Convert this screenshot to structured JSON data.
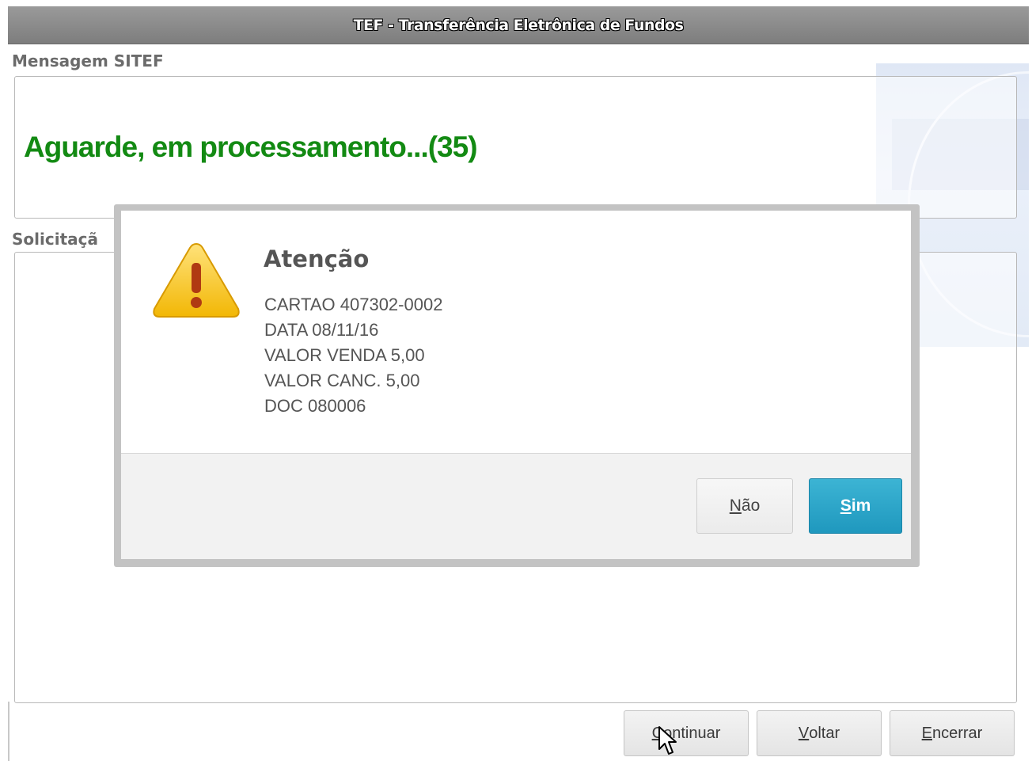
{
  "window": {
    "title": "TEF - Transferência Eletrônica de Fundos"
  },
  "message_group": {
    "label": "Mensagem SITEF",
    "text": "Aguarde, em processamento...(35)",
    "text_color": "#138a13"
  },
  "request_group": {
    "label_visible": "Solicitaçã"
  },
  "buttons": {
    "continuar": {
      "mnemonic": "C",
      "rest": "ontinuar"
    },
    "voltar": {
      "mnemonic": "V",
      "rest": "oltar"
    },
    "encerrar": {
      "mnemonic": "E",
      "rest": "ncerrar"
    }
  },
  "dialog": {
    "icon": "warning-icon",
    "title": "Atenção",
    "lines": [
      "CARTAO 407302-0002",
      "DATA 08/11/16",
      "VALOR VENDA 5,00",
      "VALOR CANC. 5,00",
      "DOC 080006"
    ],
    "no_button": {
      "mnemonic": "N",
      "rest": "ão"
    },
    "yes_button": {
      "mnemonic": "S",
      "rest": "im"
    },
    "yes_color": "#1f98be"
  }
}
